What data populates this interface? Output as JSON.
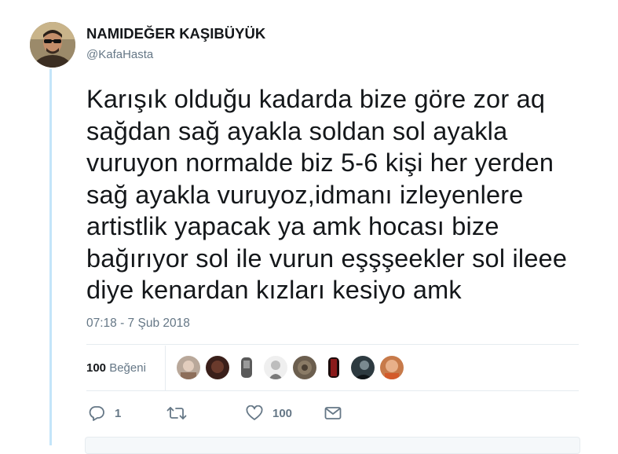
{
  "author": {
    "name": "NAMIDEĞER KAŞIBÜYÜK",
    "handle": "@KafaHasta",
    "avatar_icon": "profile-photo"
  },
  "tweet": {
    "lines": [
      "Karışık olduğu kadarda bize göre zor aq",
      "sağdan sağ ayakla soldan sol ayakla",
      "vuruyon normalde biz 5-6 kişi her yerden",
      "sağ ayakla vuruyoz,idmanı izleyenlere",
      "artistlik yapacak ya amk hocası bize",
      "bağırıyor sol ile vurun eşşşeekler sol ileee",
      "diye kenardan kızları kesiyo amk"
    ],
    "timestamp": "07:18 - 7 Şub 2018"
  },
  "stats": {
    "likes_count": "100",
    "likes_label": "Beğeni",
    "liker_avatars": [
      {
        "name": "liker-avatar-1",
        "color": "#b9a89a"
      },
      {
        "name": "liker-avatar-2",
        "color": "#3a1f1a"
      },
      {
        "name": "liker-avatar-3",
        "color": "#7a7a7a"
      },
      {
        "name": "liker-avatar-4",
        "color": "#d8d8d8"
      },
      {
        "name": "liker-avatar-5",
        "color": "#6b5e4e"
      },
      {
        "name": "liker-avatar-6",
        "color": "#5a1a1a"
      },
      {
        "name": "liker-avatar-7",
        "color": "#2d3a40"
      },
      {
        "name": "liker-avatar-8",
        "color": "#c77a4a"
      }
    ]
  },
  "actions": {
    "reply": {
      "icon": "reply-icon",
      "count": "1"
    },
    "retweet": {
      "icon": "retweet-icon",
      "count": ""
    },
    "like": {
      "icon": "heart-icon",
      "count": "100"
    },
    "message": {
      "icon": "envelope-icon",
      "count": ""
    }
  },
  "colors": {
    "text": "#14171a",
    "secondary": "#657786",
    "thread_line": "#c4e5f9",
    "divider": "#e6ecf0"
  }
}
